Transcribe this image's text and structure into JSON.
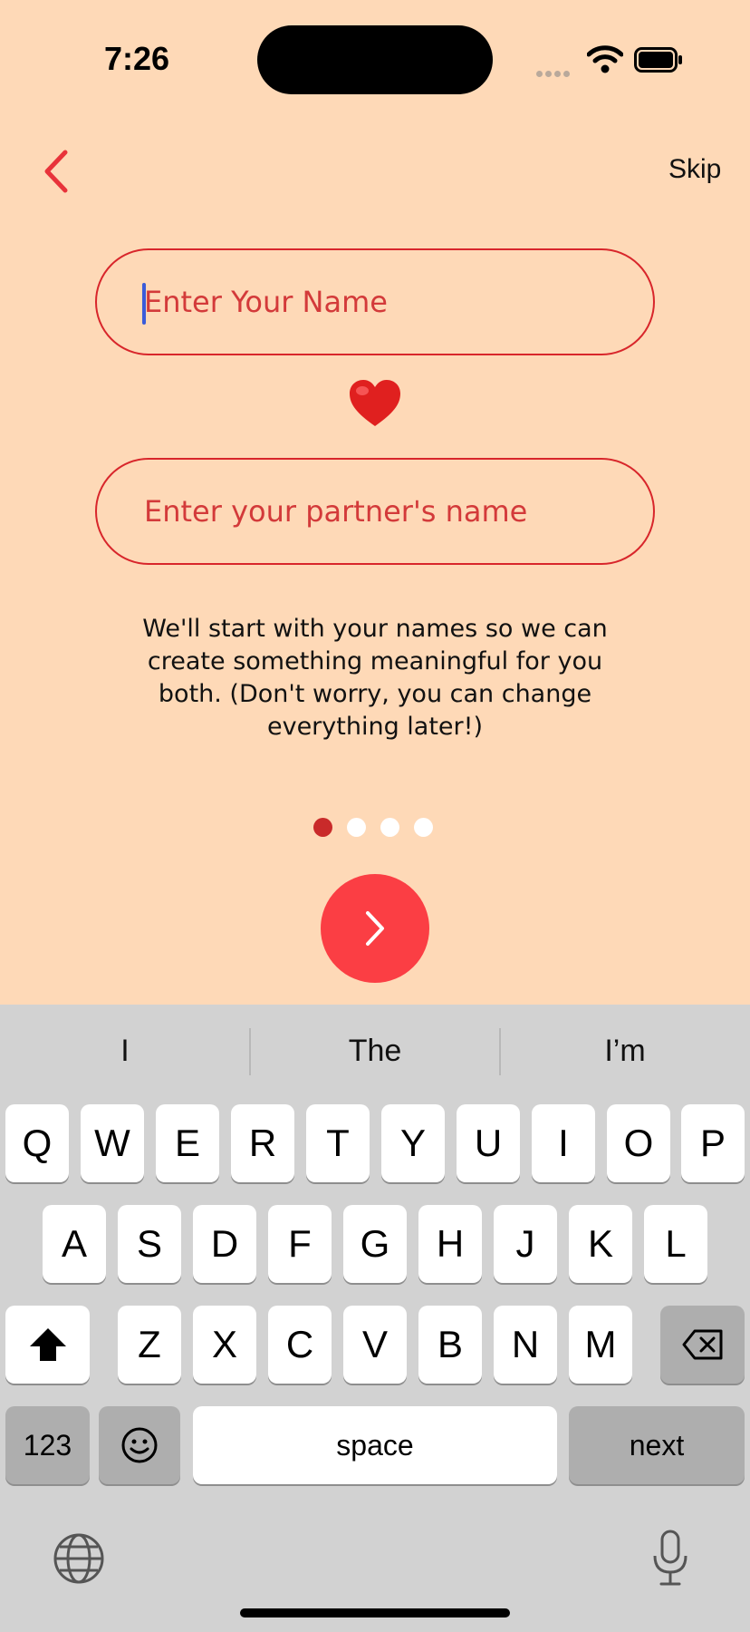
{
  "status": {
    "time": "7:26"
  },
  "nav": {
    "skip_label": "Skip"
  },
  "form": {
    "name_placeholder": "Enter Your Name",
    "name_value": "",
    "partner_placeholder": "Enter your partner's name",
    "partner_value": ""
  },
  "description": "We'll start with your names so we can create something meaningful for you both. (Don't worry, you can change everything later!)",
  "pagination": {
    "current_page": 1,
    "total_pages": 4
  },
  "colors": {
    "accent": "#fb3e44",
    "field_border": "#d8262b",
    "background": "#FED9B7"
  },
  "keyboard": {
    "suggestions": [
      "I",
      "The",
      "I’m"
    ],
    "row1": [
      "Q",
      "W",
      "E",
      "R",
      "T",
      "Y",
      "U",
      "I",
      "O",
      "P"
    ],
    "row2": [
      "A",
      "S",
      "D",
      "F",
      "G",
      "H",
      "J",
      "K",
      "L"
    ],
    "row3": [
      "Z",
      "X",
      "C",
      "V",
      "B",
      "N",
      "M"
    ],
    "numbers_label": "123",
    "space_label": "space",
    "next_label": "next",
    "icons": [
      "shift-icon",
      "backspace-icon",
      "emoji-icon",
      "globe-icon",
      "microphone-icon"
    ]
  }
}
